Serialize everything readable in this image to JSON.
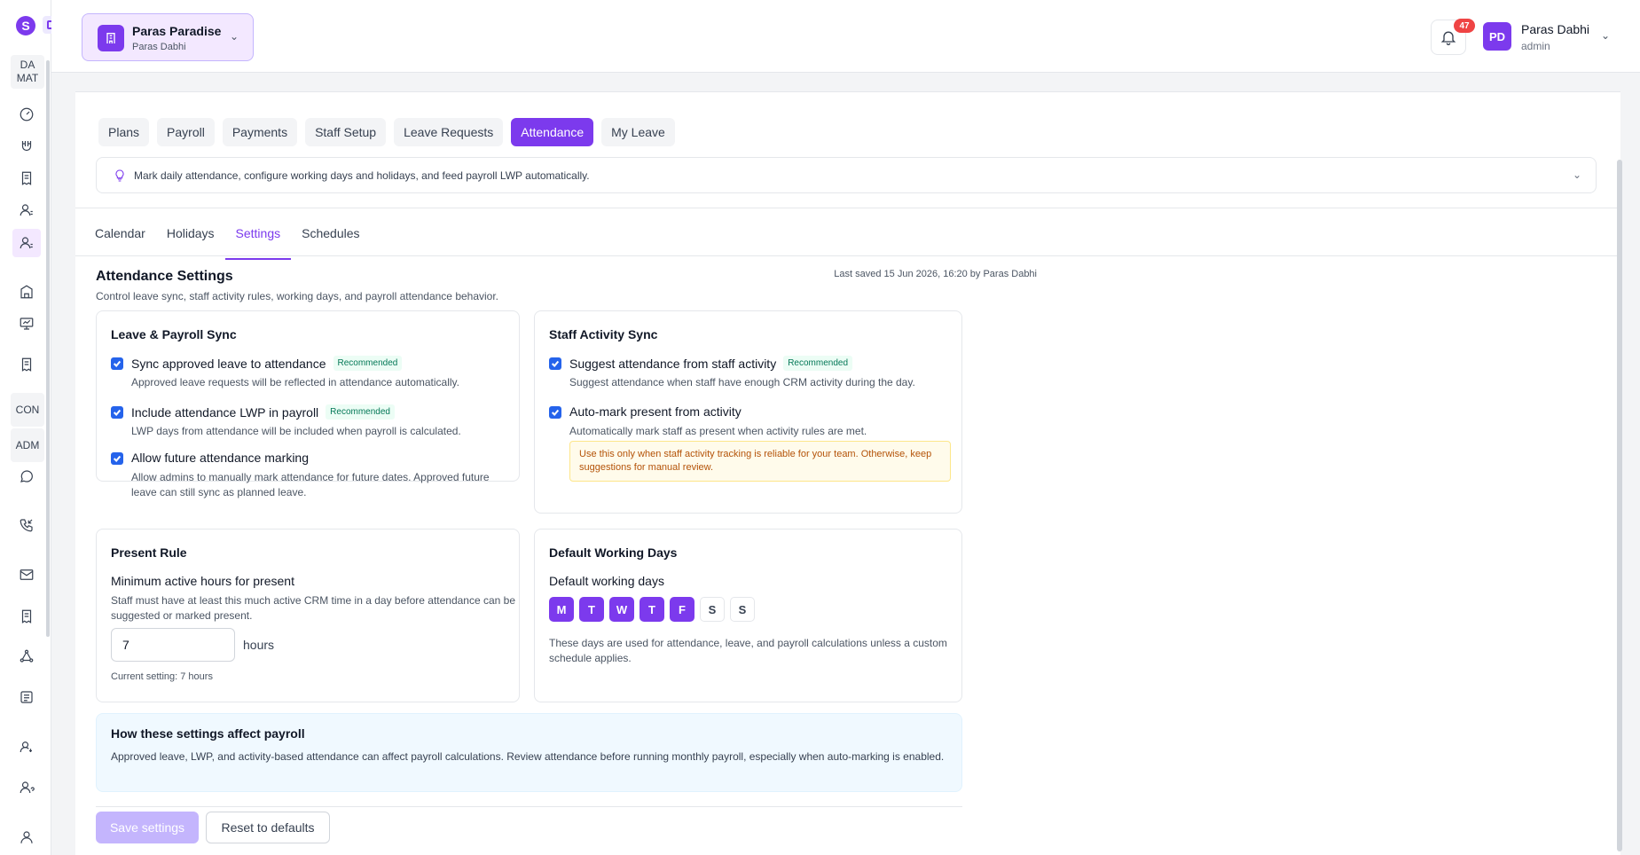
{
  "sidebar": {
    "logo": "S",
    "sections": [
      {
        "line1": "DA",
        "line2": "MAT"
      },
      {
        "line1": "CON",
        "line2": ""
      },
      {
        "line1": "ADM",
        "line2": ""
      }
    ],
    "icons": [
      "gauge-icon",
      "magnet-icon",
      "receipt-icon",
      "staff-icon",
      "staff-active-icon",
      "building-icon",
      "presentation-icon",
      "receipt-2-icon",
      "whatsapp-icon",
      "phone-incoming-icon",
      "mail-icon",
      "receipt-3-icon",
      "network-icon",
      "report-icon",
      "user-gear-icon",
      "user-question-icon",
      "user-icon"
    ]
  },
  "header": {
    "org_name": "Paras Paradise",
    "org_sub": "Paras Dabhi",
    "notification_count": "47",
    "avatar_initials": "PD",
    "user_name": "Paras Dabhi",
    "user_role": "admin"
  },
  "top_tabs": [
    {
      "label": "Plans",
      "active": false
    },
    {
      "label": "Payroll",
      "active": false
    },
    {
      "label": "Payments",
      "active": false
    },
    {
      "label": "Staff Setup",
      "active": false
    },
    {
      "label": "Leave Requests",
      "active": false
    },
    {
      "label": "Attendance",
      "active": true
    },
    {
      "label": "My Leave",
      "active": false
    }
  ],
  "hint": "Mark daily attendance, configure working days and holidays, and feed payroll LWP automatically.",
  "sub_tabs": [
    {
      "label": "Calendar",
      "active": false
    },
    {
      "label": "Holidays",
      "active": false
    },
    {
      "label": "Settings",
      "active": true
    },
    {
      "label": "Schedules",
      "active": false
    }
  ],
  "settings": {
    "title": "Attendance Settings",
    "subtitle": "Control leave sync, staff activity rules, working days, and payroll attendance behavior.",
    "last_saved": "Last saved 15 Jun 2026, 16:20 by Paras Dabhi"
  },
  "leave_sync": {
    "title": "Leave & Payroll Sync",
    "options": [
      {
        "label": "Sync approved leave to attendance",
        "badge": "Recommended",
        "desc": "Approved leave requests will be reflected in attendance automatically.",
        "checked": true
      },
      {
        "label": "Include attendance LWP in payroll",
        "badge": "Recommended",
        "desc": "LWP days from attendance will be included when payroll is calculated.",
        "checked": true
      },
      {
        "label": "Allow future attendance marking",
        "badge": "",
        "desc": "Allow admins to manually mark attendance for future dates. Approved future leave can still sync as planned leave.",
        "checked": true
      }
    ]
  },
  "activity_sync": {
    "title": "Staff Activity Sync",
    "options": [
      {
        "label": "Suggest attendance from staff activity",
        "badge": "Recommended",
        "desc": "Suggest attendance when staff have enough CRM activity during the day.",
        "checked": true
      },
      {
        "label": "Auto-mark present from activity",
        "badge": "",
        "desc": "Automatically mark staff as present when activity rules are met.",
        "checked": true
      }
    ],
    "warning": "Use this only when staff activity tracking is reliable for your team. Otherwise, keep suggestions for manual review."
  },
  "present_rule": {
    "title": "Present Rule",
    "field_label": "Minimum active hours for present",
    "field_desc": "Staff must have at least this much active CRM time in a day before attendance can be suggested or marked present.",
    "value": "7",
    "unit": "hours",
    "current": "Current setting: 7 hours"
  },
  "working_days": {
    "title": "Default Working Days",
    "field_label": "Default working days",
    "days": [
      {
        "label": "M",
        "on": true
      },
      {
        "label": "T",
        "on": true
      },
      {
        "label": "W",
        "on": true
      },
      {
        "label": "T",
        "on": true
      },
      {
        "label": "F",
        "on": true
      },
      {
        "label": "S",
        "on": false
      },
      {
        "label": "S",
        "on": false
      }
    ],
    "desc": "These days are used for attendance, leave, and payroll calculations unless a custom schedule applies."
  },
  "payroll_info": {
    "title": "How these settings affect payroll",
    "text": "Approved leave, LWP, and activity-based attendance can affect payroll calculations. Review attendance before running monthly payroll, especially when auto-marking is enabled."
  },
  "actions": {
    "save": "Save settings",
    "reset": "Reset to defaults"
  },
  "colors": {
    "accent": "#7c3aed",
    "checkbox": "#2563eb",
    "badge_bg": "#ef4444",
    "recommended": "#047857",
    "warning": "#b45309"
  }
}
